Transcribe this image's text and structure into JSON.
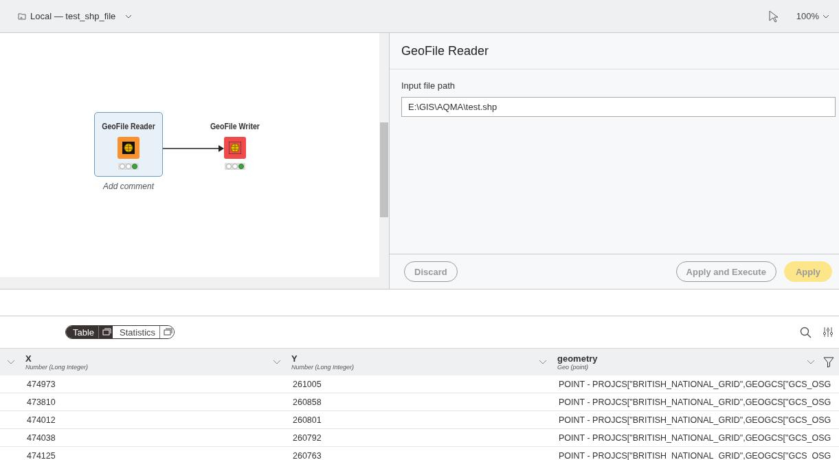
{
  "header": {
    "workflow_title": "Local — test_shp_file",
    "zoom": "100%"
  },
  "canvas": {
    "nodes": [
      {
        "name": "GeoFile Reader",
        "kind": "reader",
        "selected": true,
        "executed": true,
        "comment": "Add comment"
      },
      {
        "name": "GeoFile Writer",
        "kind": "writer",
        "selected": false,
        "executed": true
      }
    ]
  },
  "dialog": {
    "title": "GeoFile Reader",
    "field_label": "Input file path",
    "field_value": "E:\\GIS\\AQMA\\test.shp",
    "buttons": [
      {
        "label": "Discard",
        "kind": "secondary"
      },
      {
        "label": "Apply and Execute",
        "kind": "secondary"
      },
      {
        "label": "Apply",
        "kind": "primary"
      }
    ]
  },
  "output": {
    "tabs": [
      {
        "label": "Table",
        "selected": true
      },
      {
        "label": "Statistics",
        "selected": false
      }
    ],
    "columns": [
      {
        "name": "X",
        "type": "Number (Long Integer)"
      },
      {
        "name": "Y",
        "type": "Number (Long Integer)"
      },
      {
        "name": "geometry",
        "type": "Geo (point)"
      }
    ],
    "rows": [
      [
        "474973",
        "261005",
        "POINT - PROJCS[\"BRITISH_NATIONAL_GRID\",GEOGCS[\"GCS_OSG"
      ],
      [
        "473810",
        "260858",
        "POINT - PROJCS[\"BRITISH_NATIONAL_GRID\",GEOGCS[\"GCS_OSG"
      ],
      [
        "474012",
        "260801",
        "POINT - PROJCS[\"BRITISH_NATIONAL_GRID\",GEOGCS[\"GCS_OSG"
      ],
      [
        "474038",
        "260792",
        "POINT - PROJCS[\"BRITISH_NATIONAL_GRID\",GEOGCS[\"GCS_OSG"
      ],
      [
        "474125",
        "260763",
        "POINT - PROJCS[\"BRITISH_NATIONAL_GRID\",GEOGCS[\"GCS_OSG"
      ]
    ]
  }
}
